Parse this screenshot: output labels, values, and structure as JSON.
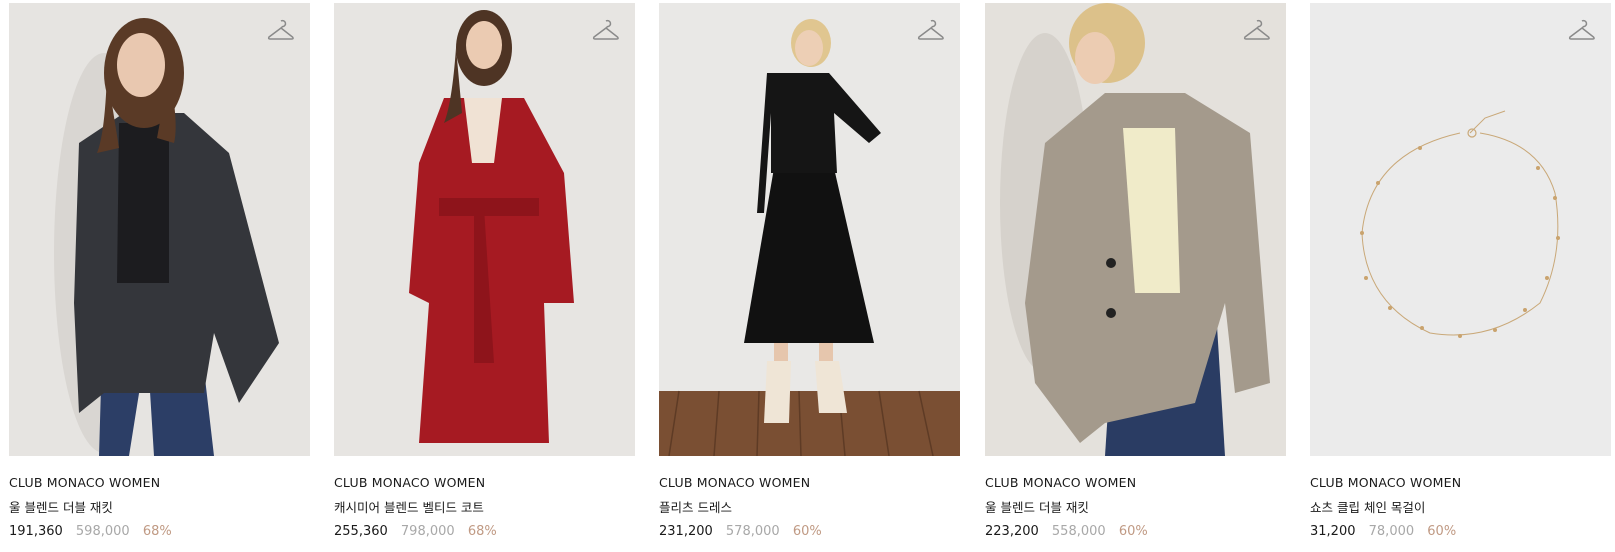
{
  "products": [
    {
      "brand": "CLUB MONACO WOMEN",
      "name": "울 블렌드 더블 재킷",
      "sale_price": "191,360",
      "original_price": "598,000",
      "discount": "68%",
      "wishlist_icon": "hanger-icon"
    },
    {
      "brand": "CLUB MONACO WOMEN",
      "name": "캐시미어 블렌드 벨티드 코트",
      "sale_price": "255,360",
      "original_price": "798,000",
      "discount": "68%",
      "wishlist_icon": "hanger-icon"
    },
    {
      "brand": "CLUB MONACO WOMEN",
      "name": "플리츠 드레스",
      "sale_price": "231,200",
      "original_price": "578,000",
      "discount": "60%",
      "wishlist_icon": "hanger-icon"
    },
    {
      "brand": "CLUB MONACO WOMEN",
      "name": "울 블렌드 더블 재킷",
      "sale_price": "223,200",
      "original_price": "558,000",
      "discount": "60%",
      "wishlist_icon": "hanger-icon"
    },
    {
      "brand": "CLUB MONACO WOMEN",
      "name": "쇼츠 클립 체인 목걸이",
      "sale_price": "31,200",
      "original_price": "78,000",
      "discount": "60%",
      "wishlist_icon": "hanger-icon"
    }
  ],
  "colors": {
    "discount": "#c09a84",
    "original_price": "#a8a8a8",
    "text": "#1a1a1a"
  }
}
